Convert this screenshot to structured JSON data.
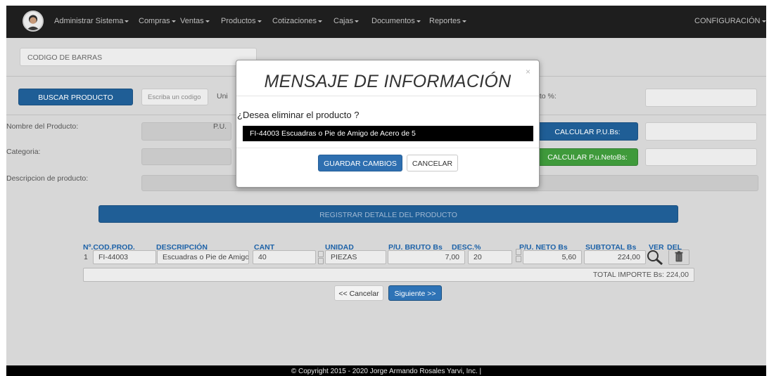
{
  "nav": {
    "items": [
      {
        "label": "Administrar Sistema"
      },
      {
        "label": "Compras"
      },
      {
        "label": "Ventas"
      },
      {
        "label": "Productos"
      },
      {
        "label": "Cotizaciones"
      },
      {
        "label": "Cajas"
      },
      {
        "label": "Documentos"
      },
      {
        "label": "Reportes"
      }
    ],
    "config_label": "CONFIGURACIÓN"
  },
  "form": {
    "barcode_placeholder": "CODIGO DE BARRAS",
    "search_button": "BUSCAR PRODUCTO",
    "search_placeholder": "Escriba un codigo",
    "unit_label": "Uni",
    "discount_label": "nto %:",
    "name_label": "Nombre del Producto:",
    "pu_label": "P.U.",
    "calc_pu_button": "CALCULAR P.U.Bs:",
    "category_label": "Categoria:",
    "calc_net_button": "CALCULAR P.u.NetoBs:",
    "description_label": "Descripcion de producto:",
    "register_button": "REGISTRAR DETALLE DEL PRODUCTO"
  },
  "table": {
    "headers": [
      "Nº.COD.PROD.",
      "DESCRIPCIÓN",
      "CANT",
      "UNIDAD",
      "P/U. BRUTO Bs",
      "DESC.%",
      "P/U. NETO Bs",
      "SUBTOTAL Bs",
      "VER",
      "DEL"
    ],
    "rows": [
      {
        "num": "1",
        "code": "FI-44003",
        "description": "Escuadras o Pie de Amigo",
        "qty": "40",
        "unit": "PIEZAS",
        "gross": "7,00",
        "discount": "20",
        "net": "5,60",
        "subtotal": "224,00"
      }
    ],
    "total_label": "TOTAL IMPORTE Bs: 224,00"
  },
  "pager": {
    "cancel": "<< Cancelar",
    "next": "Siguiente >>"
  },
  "modal": {
    "title": "MENSAJE DE INFORMACIÓN",
    "close": "×",
    "question": "¿Desea eliminar el producto ?",
    "product": "FI-44003  Escuadras o Pie de Amigo de Acero de 5",
    "save_button": "GUARDAR CAMBIOS",
    "cancel_button": "CANCELAR"
  },
  "footer": {
    "text": "© Copyright 2015 - 2020 Jorge Armando Rosales Yarvi, Inc. |"
  },
  "colors": {
    "navbar": "#1e1e1e",
    "primary": "#1f5e96",
    "success": "#3f9a3b",
    "header_text": "#1d62a8",
    "backdrop": "#d7d7d7"
  },
  "icons": [
    "user-avatar",
    "magnifier-icon",
    "trash-icon",
    "close-icon",
    "caret-down-icon"
  ]
}
